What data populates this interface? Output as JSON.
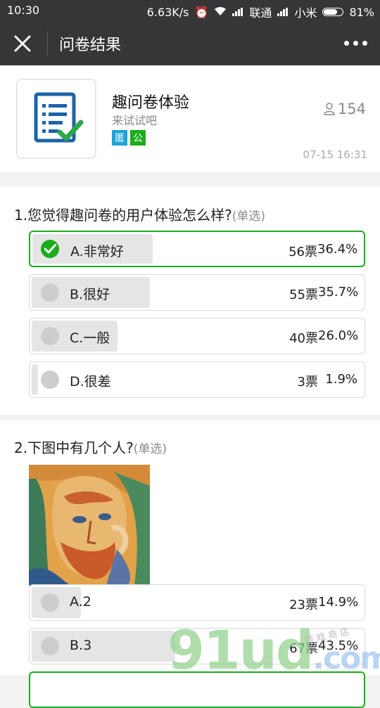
{
  "status_bar": {
    "time": "10:30",
    "speed": "6.63K/s",
    "carrier1": "联通",
    "carrier2": "小米",
    "battery": "81%",
    "battery_level": 0.81
  },
  "nav": {
    "title": "问卷结果",
    "close_icon": "close-icon",
    "more_icon": "more-dots-icon"
  },
  "survey": {
    "title": "趣问卷体验",
    "subtitle": "来试试吧",
    "tag_anonymous": "匿",
    "tag_public": "公",
    "participants": "154",
    "date": "07-15 16:31"
  },
  "questions": [
    {
      "title": "1.您觉得趣问卷的用户体验怎么样?",
      "type": "(单选)",
      "options": [
        {
          "label": "A.非常好",
          "votes": "56票",
          "percent": "36.4%",
          "fraction": 0.364,
          "chosen": true
        },
        {
          "label": "B.很好",
          "votes": "55票",
          "percent": "35.7%",
          "fraction": 0.357,
          "chosen": false
        },
        {
          "label": "C.一般",
          "votes": "40票",
          "percent": "26.0%",
          "fraction": 0.26,
          "chosen": false
        },
        {
          "label": "D.很差",
          "votes": "3票",
          "percent": "1.9%",
          "fraction": 0.019,
          "chosen": false
        }
      ]
    },
    {
      "title": "2.下图中有几个人?",
      "type": "(单选)",
      "options": [
        {
          "label": "A.2",
          "votes": "23票",
          "percent": "14.9%",
          "fraction": 0.149,
          "chosen": false
        },
        {
          "label": "B.3",
          "votes": "67票",
          "percent": "43.5%",
          "fraction": 0.435,
          "chosen": false
        }
      ]
    }
  ],
  "watermark": {
    "text": "91ud",
    "domain": ".com",
    "small": "游 戏 商 店"
  },
  "colors": {
    "accent_green": "#1aad19",
    "bar_grey": "#e5e5e5",
    "nav_bg": "#363639"
  }
}
